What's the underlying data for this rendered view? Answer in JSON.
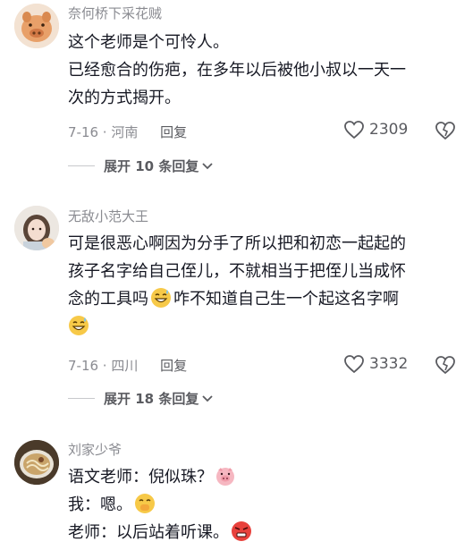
{
  "comments": [
    {
      "username": "奈何桥下采花贼",
      "lines": [
        "这个老师是个可怜人。",
        "已经愈合的伤疤，在多年以后被他小叔以一天一",
        "次的方式揭开。"
      ],
      "date_location": "7-16 · 河南",
      "reply_label": "回复",
      "likes": "2309",
      "expand_label": "展开 10 条回复"
    },
    {
      "username": "无敌小范大王",
      "lines": [
        "可是很恶心啊因为分手了所以把和初恋一起起的",
        "孩子名字给自己侄儿，不就相当于把侄儿当成怀",
        "念的工具吗",
        "咋不知道自己生一个起这名字啊"
      ],
      "date_location": "7-16 · 四川",
      "reply_label": "回复",
      "likes": "3332",
      "expand_label": "展开 18 条回复"
    },
    {
      "username": "刘家少爷",
      "lines": [
        "语文老师：倪似珠？",
        "我：嗯。",
        "老师：以后站着听课。"
      ]
    }
  ],
  "icons": {
    "like": "heart-icon",
    "dislike": "broken-heart-icon",
    "expand": "chevron-down-icon"
  },
  "colors": {
    "text": "#161823",
    "secondary": "#8a8b91",
    "emoji": "#f7c948"
  }
}
